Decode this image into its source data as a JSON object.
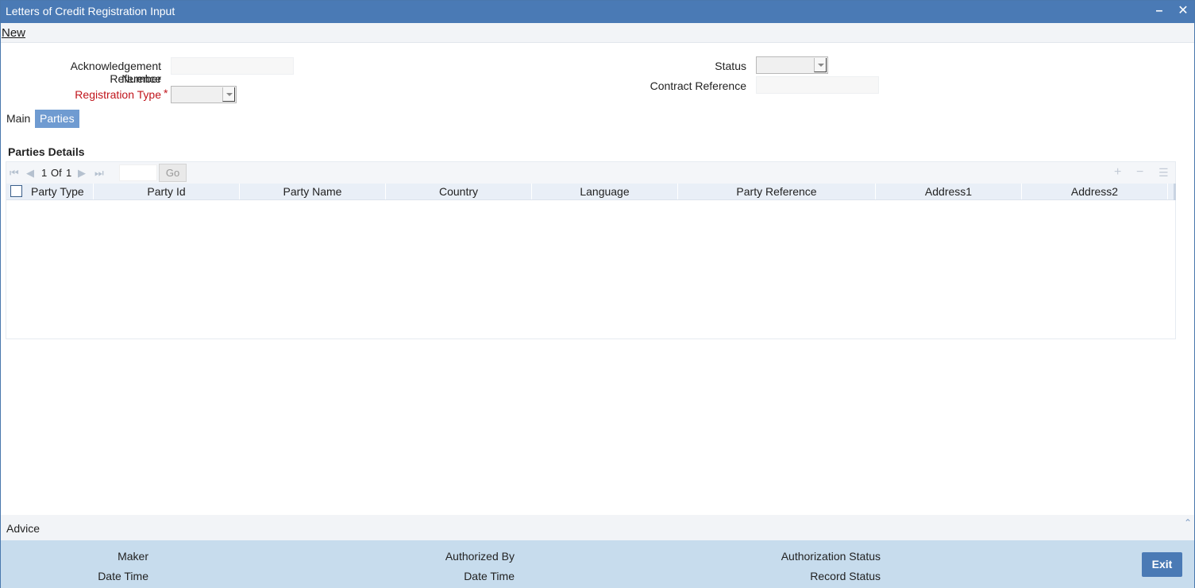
{
  "window": {
    "title": "Letters of Credit Registration Input",
    "minimize_glyph": "–",
    "close_glyph": "✕"
  },
  "menu": {
    "new_label": "New"
  },
  "form": {
    "ack_ref_label_line1": "Acknowledgement Reference",
    "ack_ref_label_line2": "Number",
    "ack_ref_value": "",
    "registration_type_label": "Registration Type",
    "required_marker": "*",
    "registration_type_value": "",
    "status_label": "Status",
    "status_value": "",
    "contract_reference_label": "Contract Reference",
    "contract_reference_value": ""
  },
  "tabs": [
    {
      "label": "Main",
      "active": false
    },
    {
      "label": "Parties",
      "active": true
    }
  ],
  "parties": {
    "section_title": "Parties Details",
    "pager": {
      "current": "1",
      "of_label": "Of",
      "total": "1",
      "go_label": "Go",
      "page_input": ""
    },
    "toolbar_icons": [
      "add-row-icon",
      "delete-row-icon",
      "view-details-icon"
    ],
    "columns": [
      "Party Type",
      "Party Id",
      "Party Name",
      "Country",
      "Language",
      "Party Reference",
      "Address1",
      "Address2"
    ],
    "rows": []
  },
  "advice": {
    "label": "Advice"
  },
  "footer": {
    "maker_label": "Maker",
    "maker_datetime_label": "Date Time",
    "authorized_by_label": "Authorized By",
    "authorized_datetime_label": "Date Time",
    "authorization_status_label": "Authorization Status",
    "record_status_label": "Record Status",
    "exit_label": "Exit"
  },
  "colors": {
    "titlebar": "#4a7ab5",
    "active_tab": "#6f9bd1",
    "footer": "#c7dced",
    "required": "#c0141b",
    "grid_header": "#e9eff7"
  }
}
